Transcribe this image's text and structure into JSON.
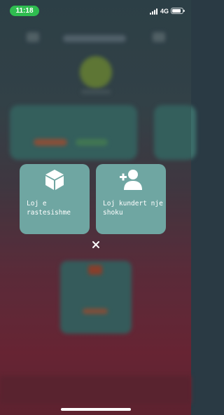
{
  "status_bar": {
    "time": "11:18",
    "network": "4G",
    "battery_level": 0.85,
    "signal_bars": 4
  },
  "modal": {
    "options": [
      {
        "icon": "cube-icon",
        "label": "Loj e rastesishme"
      },
      {
        "icon": "add-user-icon",
        "label": "Loj kundert nje shoku"
      }
    ],
    "close_icon": "close-icon"
  },
  "colors": {
    "card": "#6fa6a2",
    "status_pill": "#2fbd50",
    "text": "#ffffff"
  }
}
